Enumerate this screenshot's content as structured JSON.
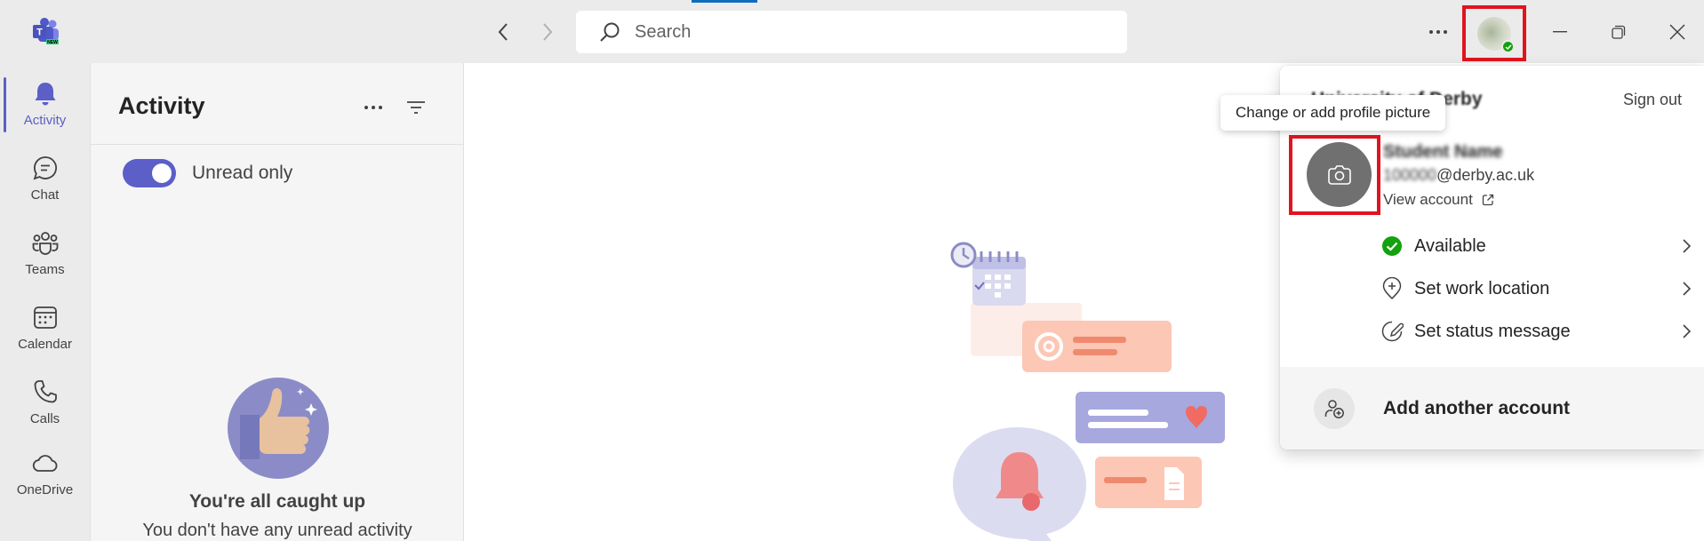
{
  "titlebar": {
    "search_placeholder": "Search",
    "logo_badge": "NEW"
  },
  "rail": {
    "items": [
      {
        "label": "Activity",
        "icon": "bell-icon"
      },
      {
        "label": "Chat",
        "icon": "chat-icon"
      },
      {
        "label": "Teams",
        "icon": "teams-icon"
      },
      {
        "label": "Calendar",
        "icon": "calendar-icon"
      },
      {
        "label": "Calls",
        "icon": "phone-icon"
      },
      {
        "label": "OneDrive",
        "icon": "cloud-icon"
      }
    ]
  },
  "activity": {
    "title": "Activity",
    "toggle_label": "Unread only",
    "empty_title": "You're all caught up",
    "empty_subtitle": "You don't have any unread activity"
  },
  "account": {
    "org_name": "University of Derby",
    "sign_out": "Sign out",
    "user_name": "Student Name",
    "email_local": "100000",
    "email_domain": "@derby.ac.uk",
    "view_account": "View account",
    "status_items": [
      {
        "label": "Available",
        "icon": "available-check-icon"
      },
      {
        "label": "Set work location",
        "icon": "location-pin-plus-icon"
      },
      {
        "label": "Set status message",
        "icon": "status-message-icon"
      }
    ],
    "add_account": "Add another account",
    "tooltip": "Change or add profile picture"
  },
  "colors": {
    "accent": "#5b5fc7",
    "presence_available": "#13a10e",
    "highlight_box": "#e0141f"
  }
}
